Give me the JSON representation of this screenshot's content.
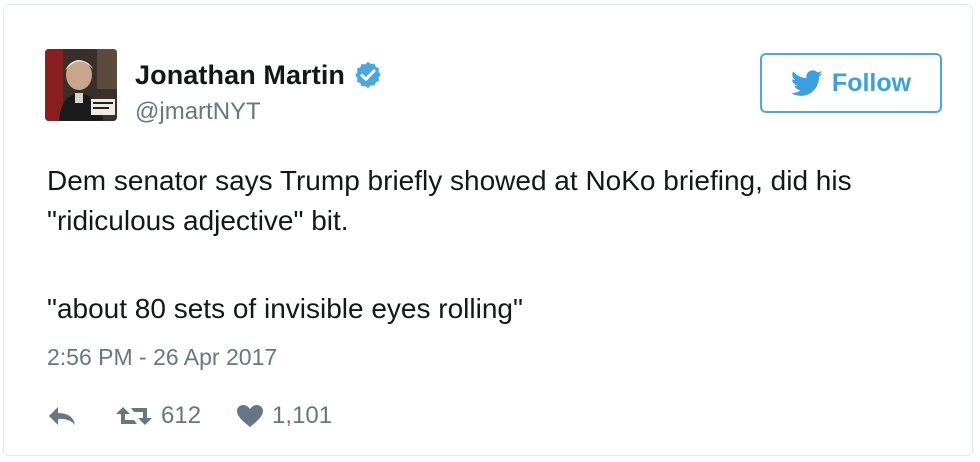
{
  "author": {
    "display_name": "Jonathan Martin",
    "handle": "@jmartNYT",
    "verified": true,
    "avatar_icon": "profile-photo"
  },
  "follow_button": {
    "label": "Follow",
    "icon": "twitter-bird-icon"
  },
  "tweet": {
    "paragraphs": [
      "Dem senator says Trump briefly showed at NoKo briefing, did his \"ridiculous adjective\" bit.",
      "\"about 80 sets of invisible eyes rolling\""
    ],
    "timestamp": "2:56 PM - 26 Apr 2017"
  },
  "actions": {
    "reply_icon": "reply-icon",
    "retweet_icon": "retweet-icon",
    "retweet_count": "612",
    "like_icon": "heart-icon",
    "like_count": "1,101"
  },
  "colors": {
    "accent": "#3ba0e2",
    "text": "#14171a",
    "muted": "#657786",
    "border": "#e1e8ed"
  }
}
